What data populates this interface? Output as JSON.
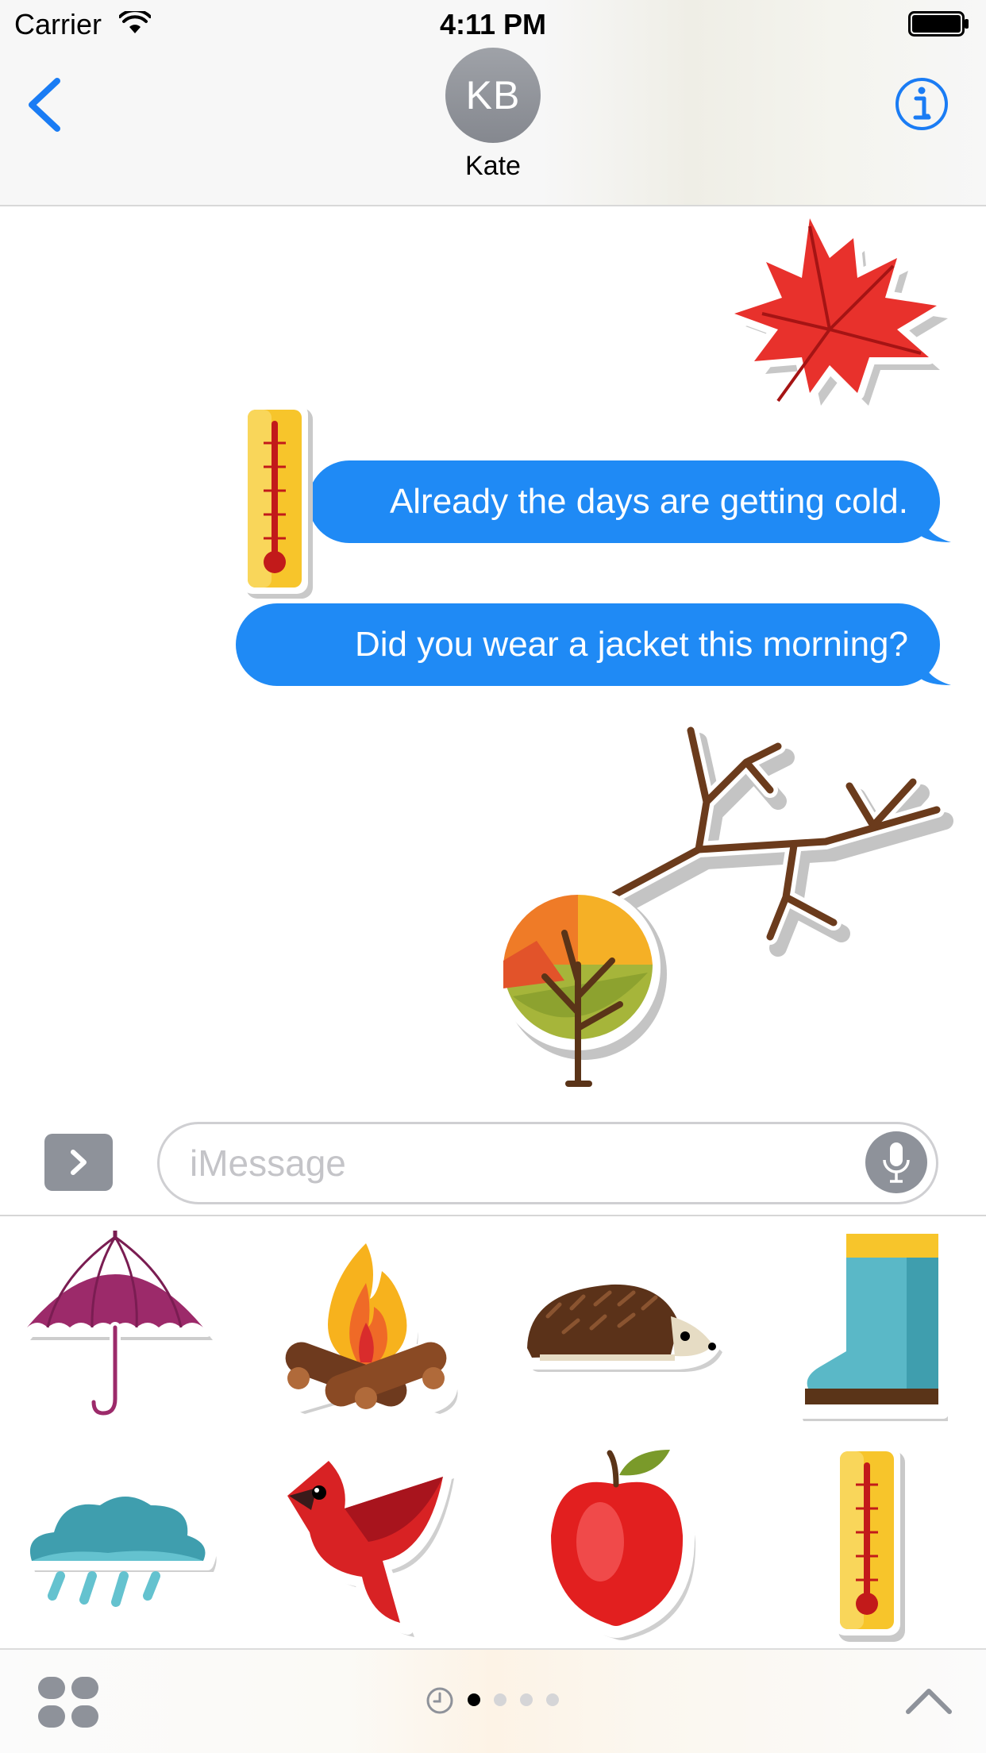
{
  "status_bar": {
    "carrier": "Carrier",
    "time": "4:11 PM",
    "wifi_icon": "wifi-icon",
    "battery_icon": "battery-icon"
  },
  "header": {
    "back_icon": "chevron-left-icon",
    "avatar_initials": "KB",
    "contact_name": "Kate",
    "info_icon": "info-icon"
  },
  "conversation": {
    "messages": [
      {
        "type": "sticker",
        "sticker": "maple-leaf-sticker"
      },
      {
        "type": "text",
        "text": "Already the days are getting cold.",
        "sticker_overlay": "thermometer-sticker"
      },
      {
        "type": "text",
        "text": "Did you wear a jacket this morning?"
      },
      {
        "type": "sticker",
        "sticker": "bare-branch-sticker"
      },
      {
        "type": "sticker",
        "sticker": "autumn-tree-sticker"
      }
    ]
  },
  "input_bar": {
    "apps_toggle_icon": "chevron-right-icon",
    "placeholder": "iMessage",
    "mic_icon": "microphone-icon"
  },
  "sticker_drawer": {
    "stickers": [
      "umbrella-sticker",
      "campfire-sticker",
      "hedgehog-sticker",
      "rain-boot-sticker",
      "rain-cloud-sticker",
      "cardinal-bird-sticker",
      "apple-sticker",
      "thermometer-sticker"
    ]
  },
  "bottom_bar": {
    "app_drawer_icon": "app-drawer-icon",
    "recent_icon": "clock-icon",
    "page_count": 4,
    "active_page": 1,
    "expand_icon": "chevron-up-icon"
  },
  "colors": {
    "bubble_blue": "#1f8af5",
    "ios_blue": "#1a7cf4",
    "gray_control": "#8e929a"
  }
}
